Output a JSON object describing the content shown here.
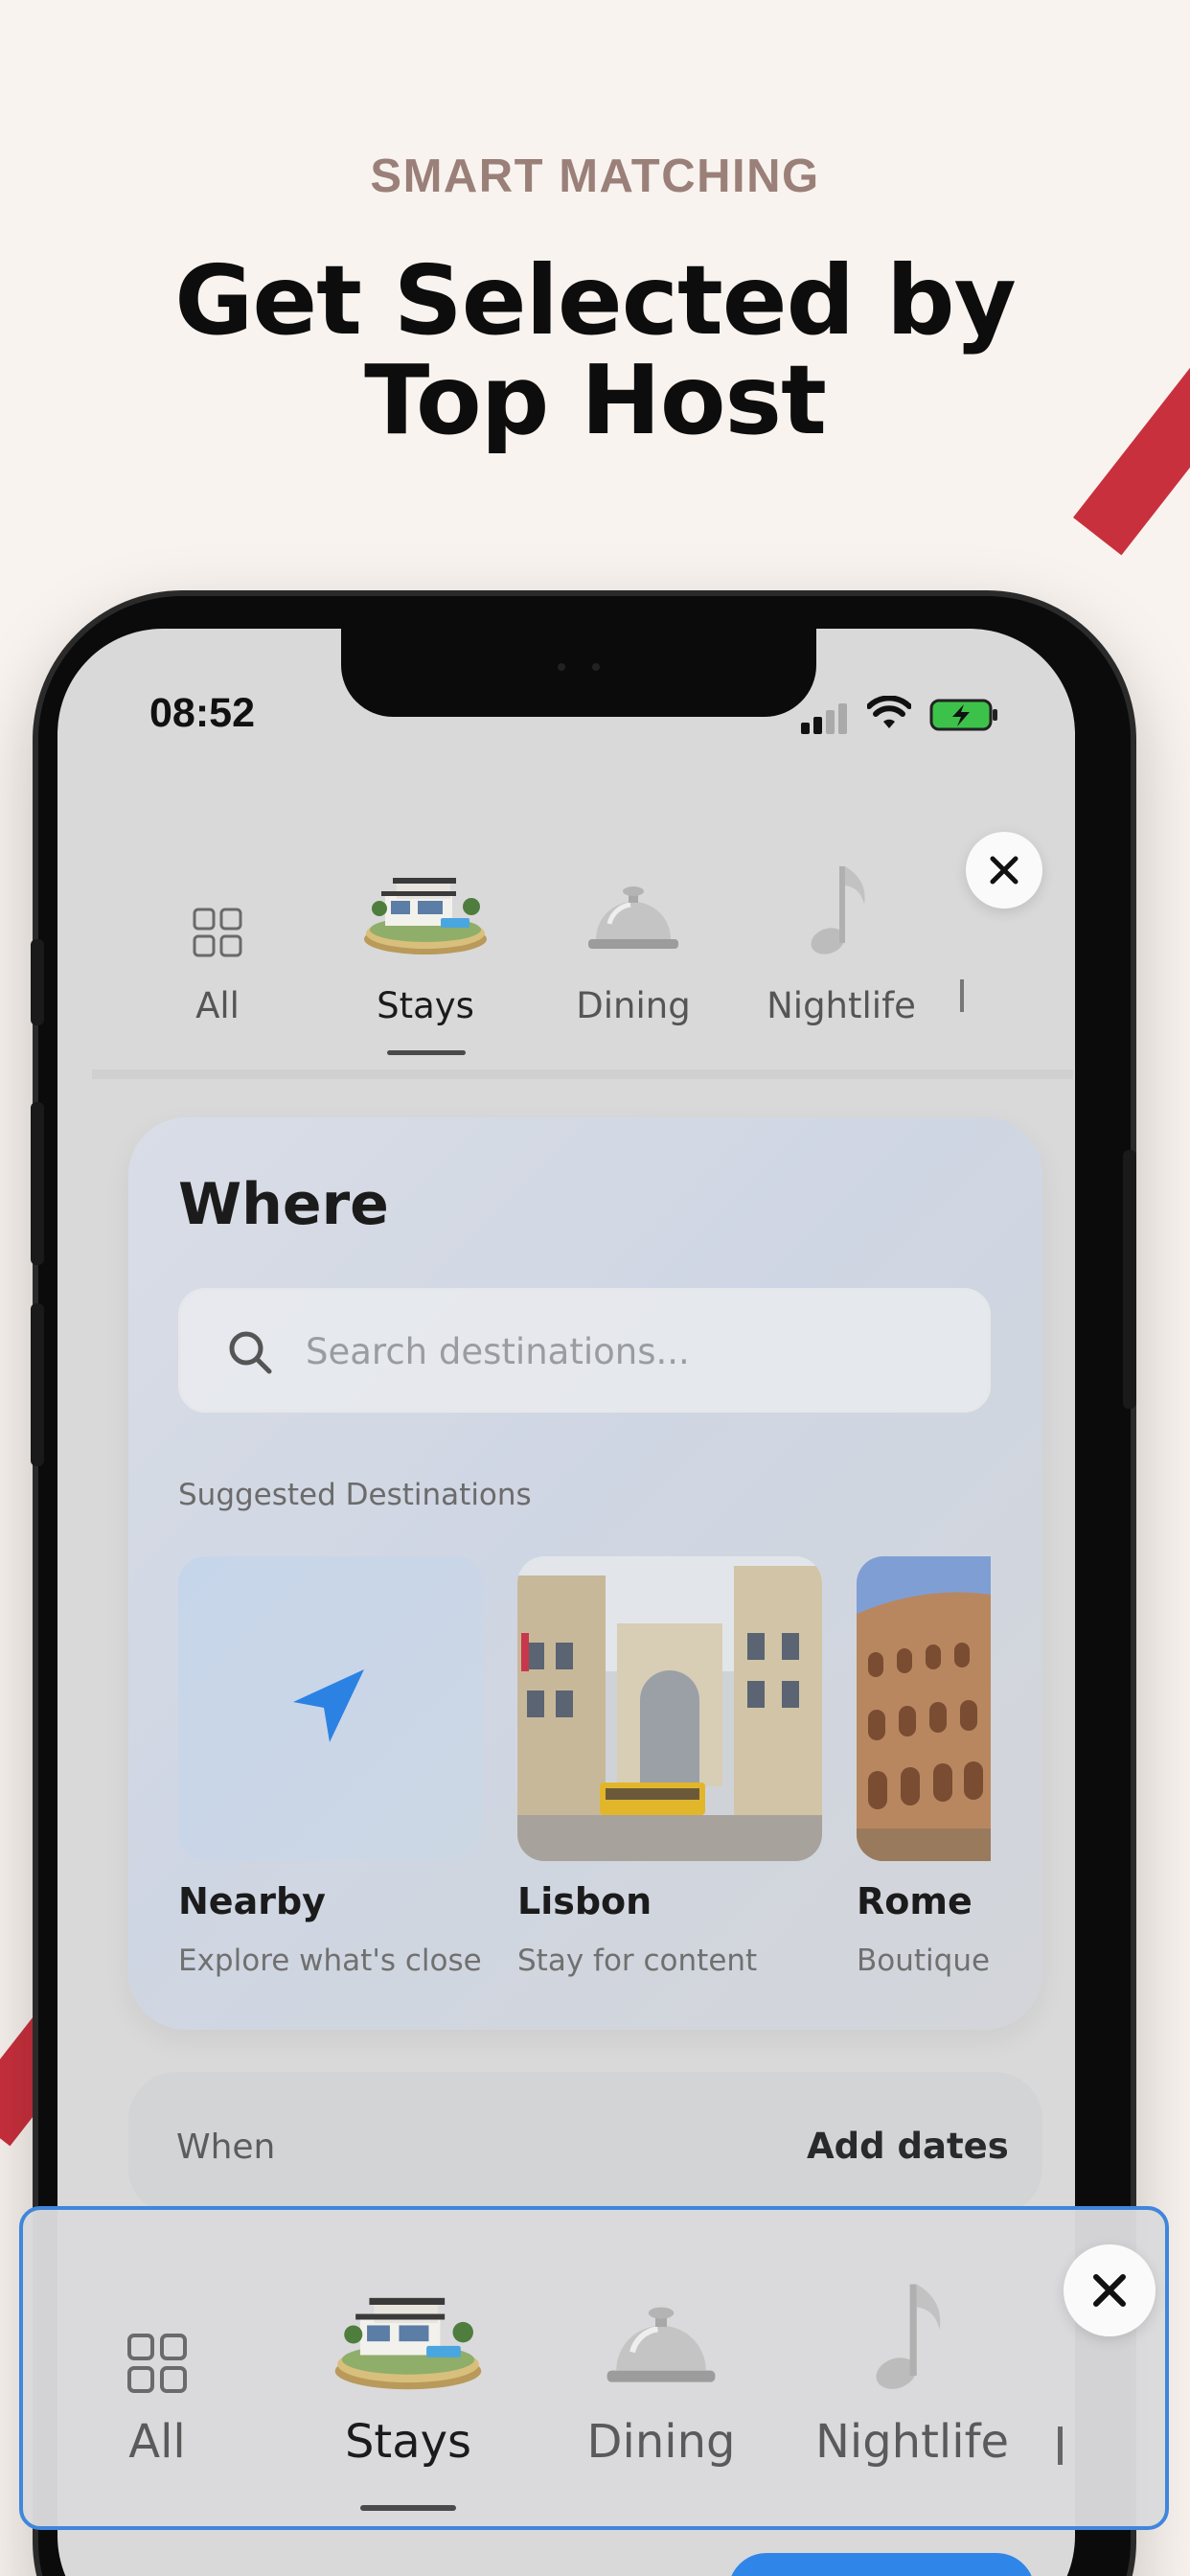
{
  "marketing": {
    "eyebrow": "SMART MATCHING",
    "headline_line1": "Get Selected by",
    "headline_line2": "Top Host"
  },
  "status_bar": {
    "time": "08:52",
    "icons": [
      "signal-icon",
      "wifi-icon",
      "battery-charging-icon"
    ]
  },
  "categories": [
    {
      "label": "All",
      "icon": "grid-icon",
      "active": false
    },
    {
      "label": "Stays",
      "icon": "house-icon",
      "active": true
    },
    {
      "label": "Dining",
      "icon": "service-bell-icon",
      "active": false
    },
    {
      "label": "Nightlife",
      "icon": "music-note-icon",
      "active": false
    }
  ],
  "where": {
    "title": "Where",
    "search_placeholder": "Search destinations...",
    "suggested_label": "Suggested Destinations",
    "destinations": [
      {
        "name": "Nearby",
        "subtitle": "Explore what's close",
        "icon": "navigation-arrow-icon"
      },
      {
        "name": "Lisbon",
        "subtitle": "Stay for content"
      },
      {
        "name": "Rome",
        "subtitle": "Boutique"
      }
    ]
  },
  "when": {
    "label": "When",
    "value": "Add dates"
  },
  "colors": {
    "page_bg": "#f9f3ef",
    "accent_red": "#c9303d",
    "accent_blue": "#2f86e8",
    "overlay_border": "#3f86dc"
  }
}
